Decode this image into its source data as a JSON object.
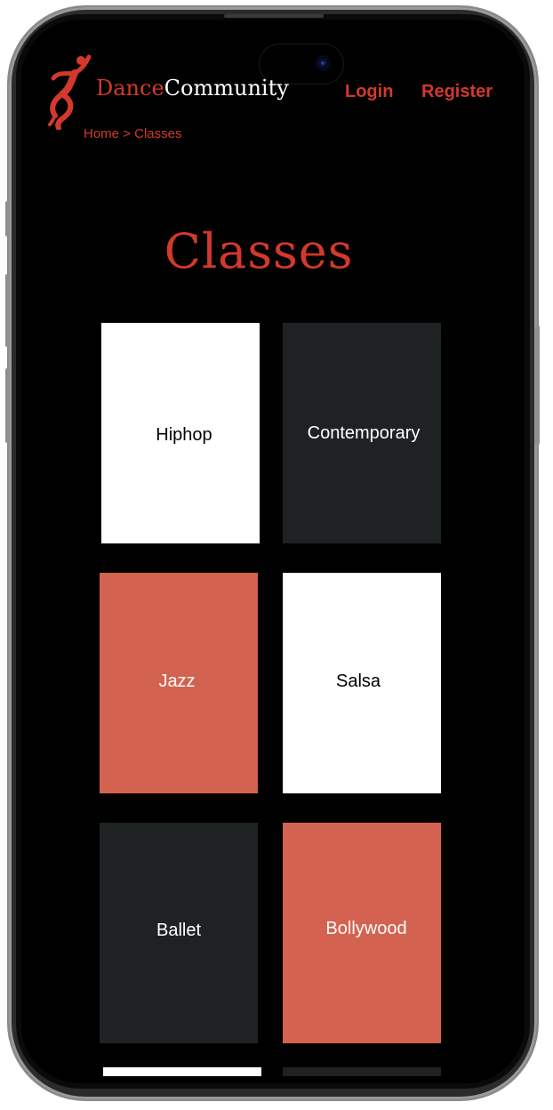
{
  "brand": {
    "name_part1": "Dance",
    "name_part2": "Community",
    "accent_color": "#d2392c",
    "logo_icon": "dancer-icon"
  },
  "nav": {
    "login_label": "Login",
    "register_label": "Register"
  },
  "breadcrumb": {
    "home": "Home",
    "separator": ">",
    "current": "Classes"
  },
  "page": {
    "title": "Classes"
  },
  "classes": [
    {
      "label": "Hiphop",
      "color": "#ffffff"
    },
    {
      "label": "Contemporary",
      "color": "#1f2223"
    },
    {
      "label": "Jazz",
      "color": "#d36350"
    },
    {
      "label": "Salsa",
      "color": "#ffffff"
    },
    {
      "label": "Ballet",
      "color": "#1f2223"
    },
    {
      "label": "Bollywood",
      "color": "#d36350"
    },
    {
      "label": "",
      "color": "#ffffff"
    },
    {
      "label": "",
      "color": "#1f2223"
    }
  ]
}
